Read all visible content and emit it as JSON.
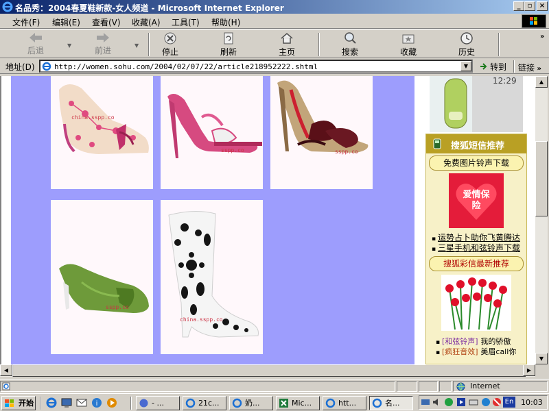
{
  "window": {
    "title": "名品秀：2004春夏鞋新款-女人频道 - Microsoft Internet Explorer"
  },
  "menu": [
    "文件(F)",
    "编辑(E)",
    "查看(V)",
    "收藏(A)",
    "工具(T)",
    "帮助(H)"
  ],
  "toolbar": {
    "back": "后退",
    "forward": "前进",
    "stop": "停止",
    "refresh": "刷新",
    "home": "主页",
    "search": "搜索",
    "favorites": "收藏",
    "history": "历史"
  },
  "address": {
    "label": "地址(D)",
    "url": "http://women.sohu.com/2004/02/07/22/article218952222.shtml",
    "go": "转到",
    "links": "链接"
  },
  "watermarks": [
    "china.sspp.co",
    "sspp.co",
    "sspp.co",
    "sspp.co",
    "china.sspp.co"
  ],
  "sidebar": {
    "phone_time": "12:29",
    "header": "搜狐短信推荐",
    "pill1": "免费图片铃声下载",
    "love_text": "爱情保险",
    "links1": [
      "运势占卜助你飞黄腾达",
      "三星手机和弦铃声下载"
    ],
    "pill2": "搜狐彩信最新推荐",
    "links2": [
      {
        "tag": "[和弦铃声]",
        "text": "我的骄傲"
      },
      {
        "tag": "[疯狂音效]",
        "text": "美眉call你"
      }
    ]
  },
  "status": {
    "zone": "Internet"
  },
  "taskbar": {
    "start": "开始",
    "tasks": [
      "- ...",
      "21c...",
      "奶...",
      "Mic...",
      "htt...",
      "名..."
    ],
    "clock": "10:03",
    "lang": "En"
  },
  "colors": {
    "accent_title": "#0a246a",
    "page_bg": "#9d9dfd",
    "sms_header": "#b9a024",
    "sms_bg": "#f7f1c8"
  }
}
